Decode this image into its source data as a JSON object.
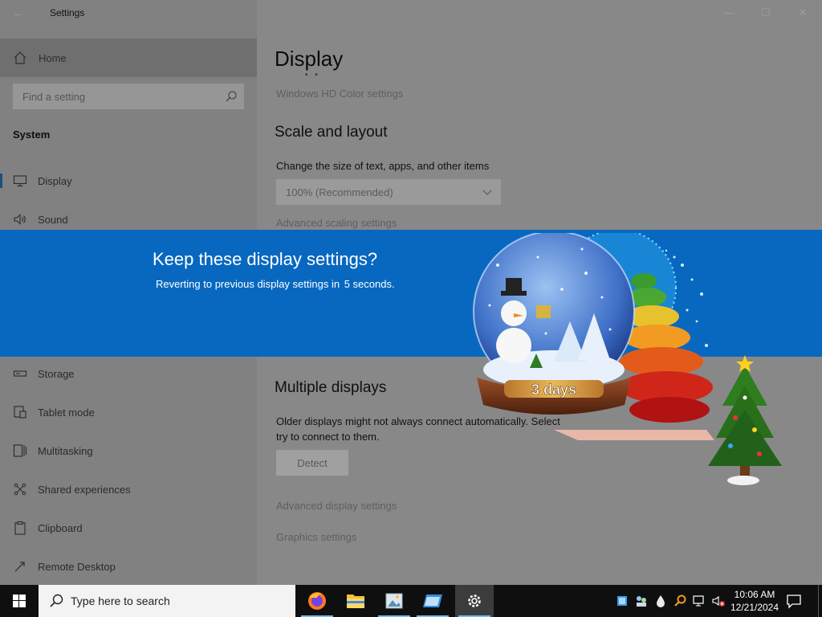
{
  "window": {
    "title": "Settings",
    "controls": {
      "minimize": "—",
      "maximize": "☐",
      "close": "✕"
    }
  },
  "sidebar": {
    "home_label": "Home",
    "search_placeholder": "Find a setting",
    "group_title": "System",
    "items": [
      {
        "label": "Display",
        "icon": "monitor-icon",
        "selected": true
      },
      {
        "label": "Sound",
        "icon": "speaker-icon"
      },
      {
        "label": "Storage",
        "icon": "storage-icon"
      },
      {
        "label": "Tablet mode",
        "icon": "tablet-mode-icon"
      },
      {
        "label": "Multitasking",
        "icon": "multitasking-icon"
      },
      {
        "label": "Shared experiences",
        "icon": "shared-experiences-icon"
      },
      {
        "label": "Clipboard",
        "icon": "clipboard-icon"
      },
      {
        "label": "Remote Desktop",
        "icon": "remote-desktop-icon"
      }
    ]
  },
  "main": {
    "page_title": "Display",
    "hd_color_link": "Windows HD Color settings",
    "scale_heading": "Scale and layout",
    "scale_desc": "Change the size of text, apps, and other items",
    "scale_value": "100% (Recommended)",
    "advanced_scaling_link": "Advanced scaling settings",
    "multiple_heading": "Multiple displays",
    "multiple_desc_line1": "Older displays might not always connect automatically. Select",
    "multiple_desc_line2": "try to connect to them.",
    "detect_button": "Detect",
    "advanced_display_link": "Advanced display settings",
    "graphics_link": "Graphics settings"
  },
  "dialog": {
    "title": "Keep these display settings?",
    "message": "Reverting to previous display settings in",
    "seconds": "5 seconds."
  },
  "widget": {
    "countdown_label": "3 days"
  },
  "taskbar": {
    "search_placeholder": "Type here to search",
    "apps": [
      "firefox-icon",
      "file-explorer-icon",
      "photos-icon",
      "window-app-icon",
      "settings-gear-icon"
    ],
    "time": "10:06 AM",
    "date": "12/21/2024"
  },
  "colors": {
    "dialog_blue": "#0868c0",
    "taskbar": "#0f0f0f",
    "accent": "#76b9ed"
  }
}
